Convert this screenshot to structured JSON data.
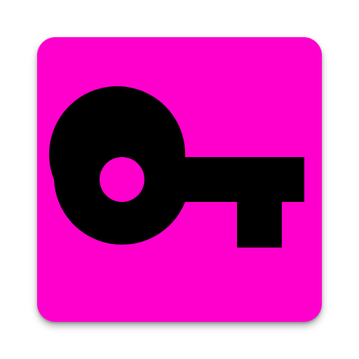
{
  "app_icon": {
    "icon": "key-icon",
    "background_color": "#ff00cc",
    "glyph_color": "#000000"
  }
}
